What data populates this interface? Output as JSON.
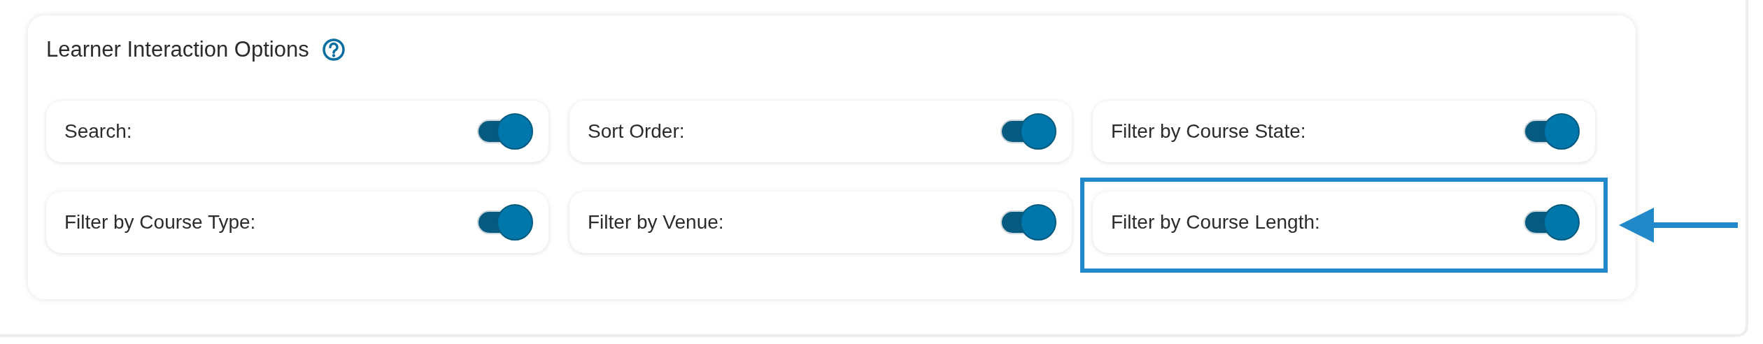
{
  "section": {
    "title": "Learner Interaction Options"
  },
  "options": [
    {
      "label": "Search:",
      "on": true,
      "highlighted": false
    },
    {
      "label": "Sort Order:",
      "on": true,
      "highlighted": false
    },
    {
      "label": "Filter by Course State:",
      "on": true,
      "highlighted": false
    },
    {
      "label": "Filter by Course Type:",
      "on": true,
      "highlighted": false
    },
    {
      "label": "Filter by Venue:",
      "on": true,
      "highlighted": false
    },
    {
      "label": "Filter by Course Length:",
      "on": true,
      "highlighted": true
    }
  ]
}
